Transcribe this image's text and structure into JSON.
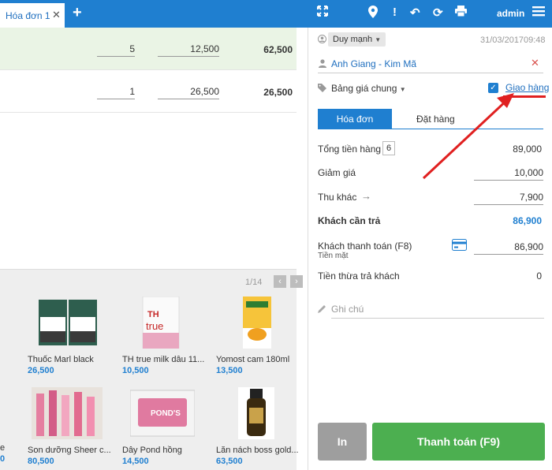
{
  "tab": {
    "title": "Hóa đơn 1"
  },
  "header": {
    "user": "admin"
  },
  "order_lines": [
    {
      "qty": "5",
      "price": "12,500",
      "total": "62,500"
    },
    {
      "qty": "1",
      "price": "26,500",
      "total": "26,500"
    }
  ],
  "pager": {
    "text": "1/14"
  },
  "products": [
    {
      "name": "Thuốc Marl black",
      "price": "26,500"
    },
    {
      "name": "TH true milk dâu 11...",
      "price": "10,500"
    },
    {
      "name": "Yomost cam 180ml",
      "price": "13,500"
    },
    {
      "name": "Son dưỡng Sheer c...",
      "price": "80,500"
    },
    {
      "name": "Dây Pond hồng",
      "price": "14,500"
    },
    {
      "name": "Lăn nách boss gold...",
      "price": "63,500"
    }
  ],
  "partial_col": {
    "line1": "e",
    "line2": "0"
  },
  "invoice": {
    "seller": "Duy mạnh",
    "date": "31/03/2017",
    "time": "09:48",
    "customer": "Anh Giang - Kim Mã",
    "price_list": "Bảng giá chung",
    "delivery_label": "Giao hàng",
    "tabs": {
      "invoice": "Hóa đơn",
      "order": "Đặt hàng"
    },
    "total_label": "Tổng tiền hàng",
    "total_count": "6",
    "total_value": "89,000",
    "discount_label": "Giảm giá",
    "discount_value": "10,000",
    "other_label": "Thu khác",
    "other_value": "7,900",
    "due_label": "Khách cần trả",
    "due_value": "86,900",
    "paid_label": "Khách thanh toán (F8)",
    "paid_sub": "Tiền mặt",
    "paid_value": "86,900",
    "change_label": "Tiền thừa trả khách",
    "change_value": "0",
    "note_placeholder": "Ghi chú",
    "print_label": "In",
    "pay_label": "Thanh toán (F9)"
  },
  "colors": {
    "brand": "#1f7fd0",
    "pay": "#4caf50",
    "annotation": "#e02020"
  }
}
